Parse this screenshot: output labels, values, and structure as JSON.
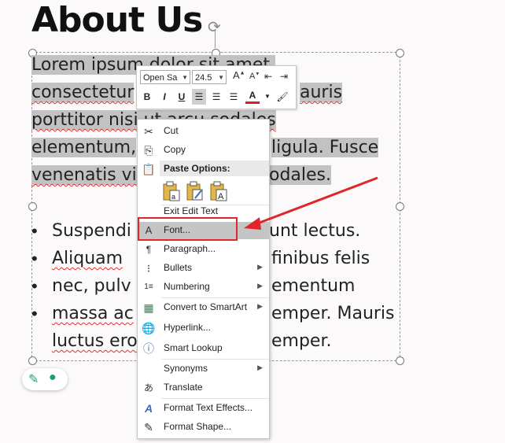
{
  "slide": {
    "title": "About Us",
    "paragraph_lines": [
      {
        "a": "Lorem ipsum dolor sit amet,",
        "b": ""
      },
      {
        "a": "consectetur",
        "b": "auris"
      },
      {
        "a": "porttitor nisi ut arcu sodales",
        "b": ""
      },
      {
        "a": "elementum,",
        "b": "ligula. Fusce"
      },
      {
        "a": "venenatis vi",
        "b": "odales."
      }
    ],
    "bullets": [
      {
        "a": "Suspendi",
        "b": "unt lectus."
      },
      {
        "a": " Aliquam",
        "b": "finibus felis"
      },
      {
        "a": " nec, pulv",
        "b": "ementum"
      },
      {
        "a": "massa ac",
        "b": "emper. Mauris"
      },
      {
        "a": "luctus ero",
        "b": "emper."
      }
    ],
    "bullet_char": "•"
  },
  "mini_toolbar": {
    "font_name": "Open Sa",
    "font_size": "24.5",
    "grow_font": "A",
    "shrink_font": "A",
    "bold": "B",
    "italic": "I",
    "underline": "U",
    "font_color_glyph": "A"
  },
  "context_menu": {
    "cut": "Cut",
    "copy": "Copy",
    "paste_options": "Paste Options:",
    "exit_edit_text": "Exit Edit Text",
    "font": "Font...",
    "paragraph": "Paragraph...",
    "bullets": "Bullets",
    "numbering": "Numbering",
    "convert_smartart": "Convert to SmartArt",
    "hyperlink": "Hyperlink...",
    "smart_lookup": "Smart Lookup",
    "synonyms": "Synonyms",
    "translate": "Translate",
    "format_text_effects": "Format Text Effects...",
    "format_shape": "Format Shape..."
  },
  "colors": {
    "highlight": "#c2c2c2",
    "annotation_red": "#e0262a",
    "font_color_bar": "#d81f26",
    "designer_green": "#1a9c84"
  }
}
